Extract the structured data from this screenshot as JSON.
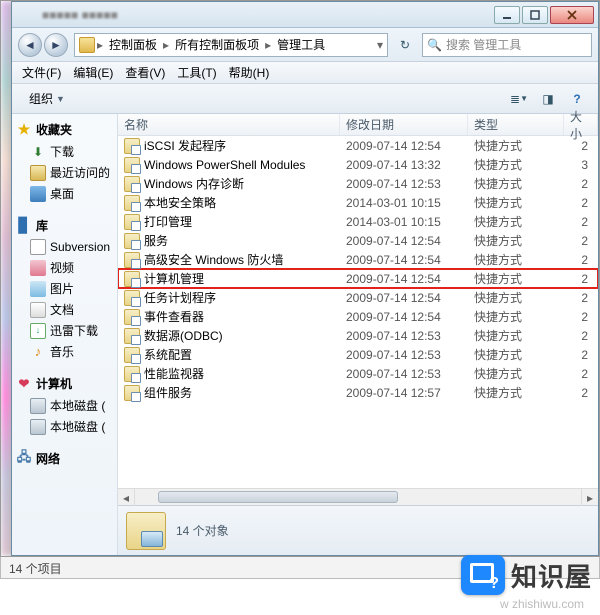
{
  "titlebar": {
    "blurred_title": "■■■■■  ■■■■■"
  },
  "breadcrumb": {
    "items": [
      "控制面板",
      "所有控制面板项",
      "管理工具"
    ],
    "refresh_tip": "↻"
  },
  "search": {
    "placeholder": "搜索 管理工具"
  },
  "menubar": {
    "file": "文件(F)",
    "edit": "编辑(E)",
    "view": "查看(V)",
    "tools": "工具(T)",
    "help": "帮助(H)"
  },
  "toolbar": {
    "organize": "组织"
  },
  "columns": {
    "name": "名称",
    "date": "修改日期",
    "type": "类型",
    "size": "大小"
  },
  "nav": {
    "favorites": "收藏夹",
    "downloads": "下载",
    "recent": "最近访问的",
    "desktop": "桌面",
    "libraries": "库",
    "subversion": "Subversion",
    "videos": "视频",
    "pictures": "图片",
    "documents": "文档",
    "xunlei": "迅雷下载",
    "music": "音乐",
    "computer": "计算机",
    "localdisk": "本地磁盘 (",
    "network": "网络"
  },
  "items": [
    {
      "name": "iSCSI 发起程序",
      "date": "2009-07-14 12:54",
      "type": "快捷方式",
      "size": "2"
    },
    {
      "name": "Windows PowerShell Modules",
      "date": "2009-07-14 13:32",
      "type": "快捷方式",
      "size": "3"
    },
    {
      "name": "Windows 内存诊断",
      "date": "2009-07-14 12:53",
      "type": "快捷方式",
      "size": "2"
    },
    {
      "name": "本地安全策略",
      "date": "2014-03-01 10:15",
      "type": "快捷方式",
      "size": "2"
    },
    {
      "name": "打印管理",
      "date": "2014-03-01 10:15",
      "type": "快捷方式",
      "size": "2"
    },
    {
      "name": "服务",
      "date": "2009-07-14 12:54",
      "type": "快捷方式",
      "size": "2"
    },
    {
      "name": "高级安全 Windows 防火墙",
      "date": "2009-07-14 12:54",
      "type": "快捷方式",
      "size": "2"
    },
    {
      "name": "计算机管理",
      "date": "2009-07-14 12:54",
      "type": "快捷方式",
      "size": "2",
      "highlight": true
    },
    {
      "name": "任务计划程序",
      "date": "2009-07-14 12:54",
      "type": "快捷方式",
      "size": "2"
    },
    {
      "name": "事件查看器",
      "date": "2009-07-14 12:54",
      "type": "快捷方式",
      "size": "2"
    },
    {
      "name": "数据源(ODBC)",
      "date": "2009-07-14 12:53",
      "type": "快捷方式",
      "size": "2"
    },
    {
      "name": "系统配置",
      "date": "2009-07-14 12:53",
      "type": "快捷方式",
      "size": "2"
    },
    {
      "name": "性能监视器",
      "date": "2009-07-14 12:53",
      "type": "快捷方式",
      "size": "2"
    },
    {
      "name": "组件服务",
      "date": "2009-07-14 12:57",
      "type": "快捷方式",
      "size": "2"
    }
  ],
  "details": {
    "summary": "14 个对象"
  },
  "status": {
    "text": "14 个项目"
  },
  "watermark": {
    "brand": "知识屋",
    "url": "w          zhishiwu.com"
  }
}
